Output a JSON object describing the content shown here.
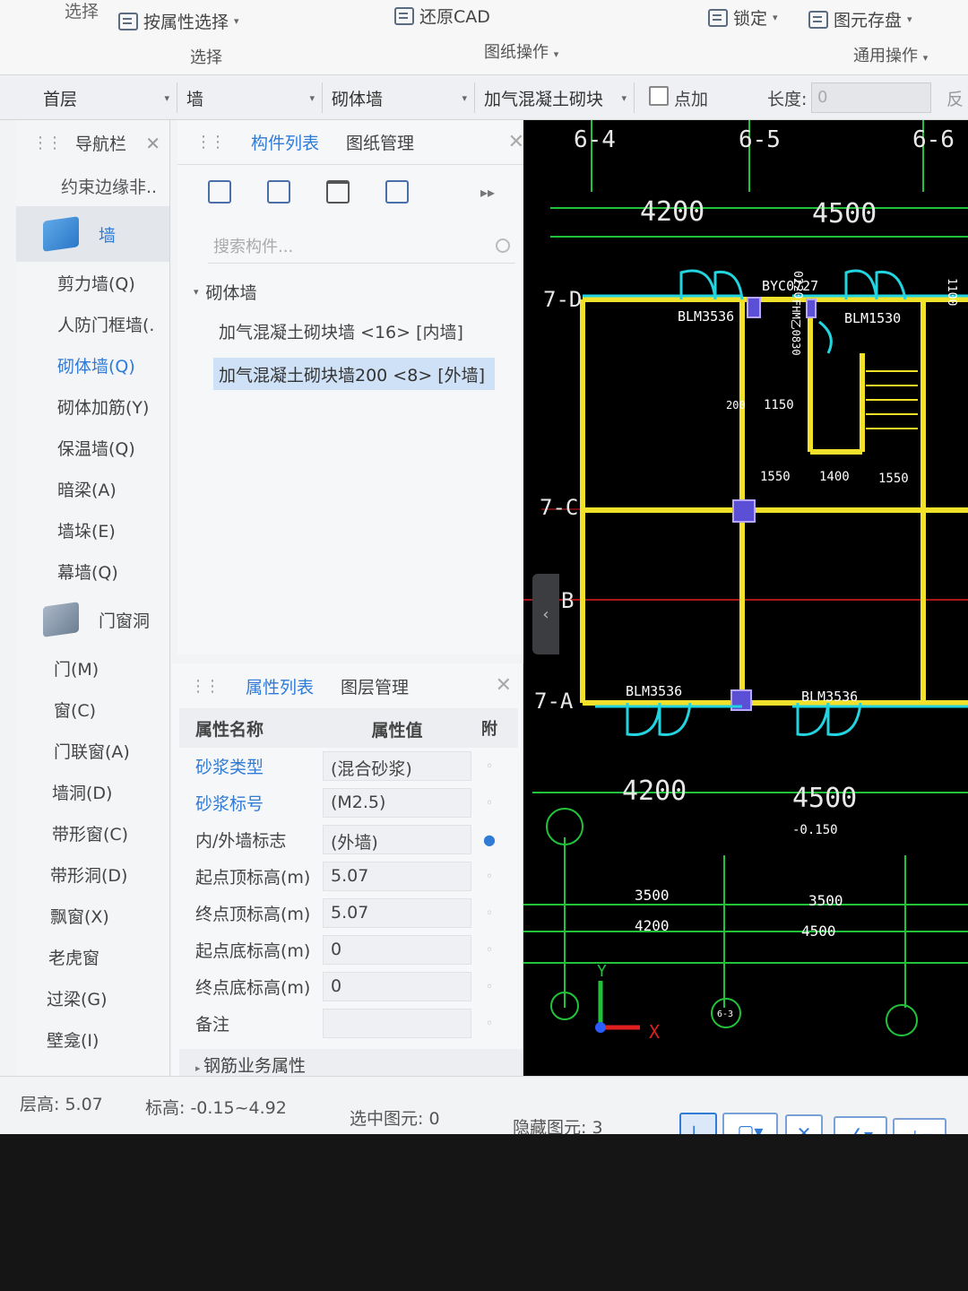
{
  "ribbon": {
    "top_left": "选择",
    "select_by_attr": "按属性选择",
    "restore_cad": "还原CAD",
    "lock": "锁定",
    "element_save": "图元存盘",
    "group_select": "选择",
    "group_drawing_ops": "图纸操作",
    "group_general_ops": "通用操作"
  },
  "selector_bar": {
    "floor": "首层",
    "category": "墙",
    "type": "砌体墙",
    "component": "加气混凝土砌块",
    "point_add_label": "点加",
    "length_label": "长度:",
    "length_value": "0",
    "reverse_label": "反"
  },
  "nav": {
    "title": "导航栏",
    "top_item": "约束边缘非..",
    "wall_category": "墙",
    "wall_items": [
      "剪力墙(Q)",
      "人防门框墙(.",
      "砌体墙(Q)",
      "砌体加筋(Y)",
      "保温墙(Q)",
      "暗梁(A)",
      "墙垛(E)",
      "幕墙(Q)"
    ],
    "door_category": "门窗洞",
    "door_items": [
      "门(M)",
      "窗(C)",
      "门联窗(A)",
      "墙洞(D)",
      "带形窗(C)",
      "带形洞(D)",
      "飘窗(X)",
      "老虎窗",
      "过梁(G)",
      "壁龛(I)"
    ]
  },
  "component_panel": {
    "tab_list": "构件列表",
    "tab_drawings": "图纸管理",
    "search_placeholder": "搜索构件...",
    "group": "砌体墙",
    "items": [
      "加气混凝土砌块墙 <16> [内墙]",
      "加气混凝土砌块墙200 <8> [外墙]"
    ]
  },
  "property_panel": {
    "tab_props": "属性列表",
    "tab_layers": "图层管理",
    "col_name": "属性名称",
    "col_value": "属性值",
    "col_attach": "附",
    "rows": [
      {
        "name": "砂浆类型",
        "value": "(混合砂浆)"
      },
      {
        "name": "砂浆标号",
        "value": "(M2.5)"
      },
      {
        "name": "内/外墙标志",
        "value": "(外墙)"
      },
      {
        "name": "起点顶标高(m)",
        "value": "5.07"
      },
      {
        "name": "终点顶标高(m)",
        "value": "5.07"
      },
      {
        "name": "起点底标高(m)",
        "value": "0"
      },
      {
        "name": "终点底标高(m)",
        "value": "0"
      },
      {
        "name": "备注",
        "value": ""
      }
    ],
    "section": "钢筋业务属性"
  },
  "cad": {
    "axis_labels_top": [
      "6-4",
      "6-5",
      "6-6"
    ],
    "dims_top": [
      "4200",
      "4500"
    ],
    "row_labels": [
      "7-D",
      "7-C",
      "B",
      "7-A"
    ],
    "tags": [
      "BYC0727",
      "BLM3536",
      "BLM1530",
      "BLM3536",
      "BLM3536",
      "FHM乙0830"
    ],
    "stair_dims": [
      "200",
      "1150",
      "1550",
      "1400",
      "1550"
    ],
    "dims_bottom": [
      "4200",
      "4500"
    ],
    "level": "-0.150",
    "sub_dims": [
      "3500",
      "3500",
      "4200",
      "4500"
    ],
    "axis_circles": [
      "6-3"
    ],
    "axis_x": "X",
    "axis_y": "Y",
    "side_dims": [
      "0220",
      "1100"
    ]
  },
  "status": {
    "floor_height_label": "层高:",
    "floor_height": "5.07",
    "elevation_label": "标高:",
    "elevation": "-0.15~4.92",
    "selected_label": "选中图元:",
    "selected": "0",
    "hidden_label": "隐藏图元:",
    "hidden": "3"
  }
}
